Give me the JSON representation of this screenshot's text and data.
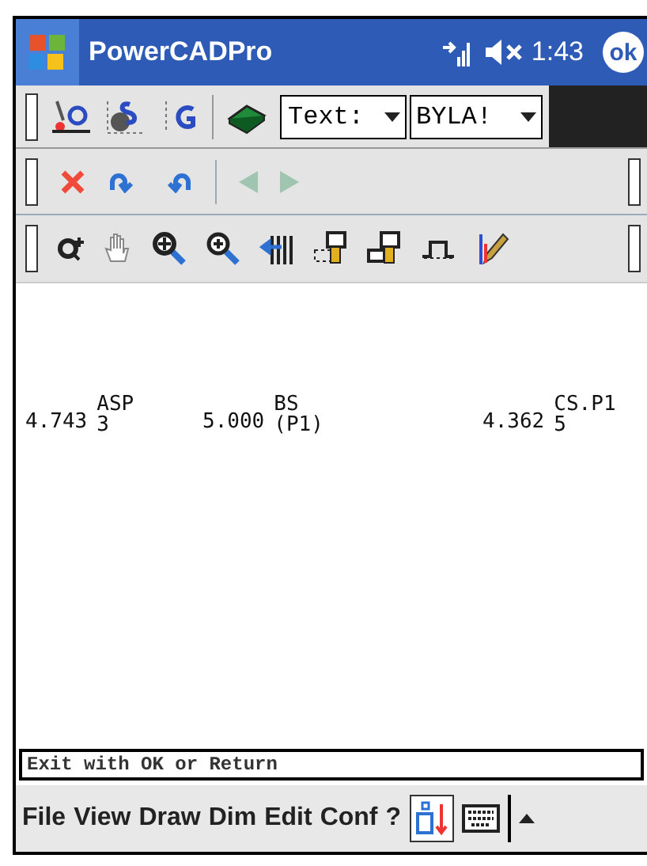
{
  "title_bar": {
    "title": "PowerCADPro",
    "time": "1:43",
    "ok": "ok"
  },
  "toolbar_1": {
    "text_style": "Text:",
    "layer": "BYLA!"
  },
  "canvas": {
    "annotations": [
      {
        "value": "4.743",
        "label": [
          "ASP",
          "3"
        ]
      },
      {
        "value": "5.000",
        "label": [
          "BS",
          "(P1)"
        ]
      },
      {
        "value": "4.362",
        "label": [
          "CS.P1",
          "5"
        ]
      }
    ]
  },
  "command_line": "Exit with OK or Return",
  "menu": [
    "File",
    "View",
    "Draw",
    "Dim",
    "Edit",
    "Conf",
    "?"
  ]
}
